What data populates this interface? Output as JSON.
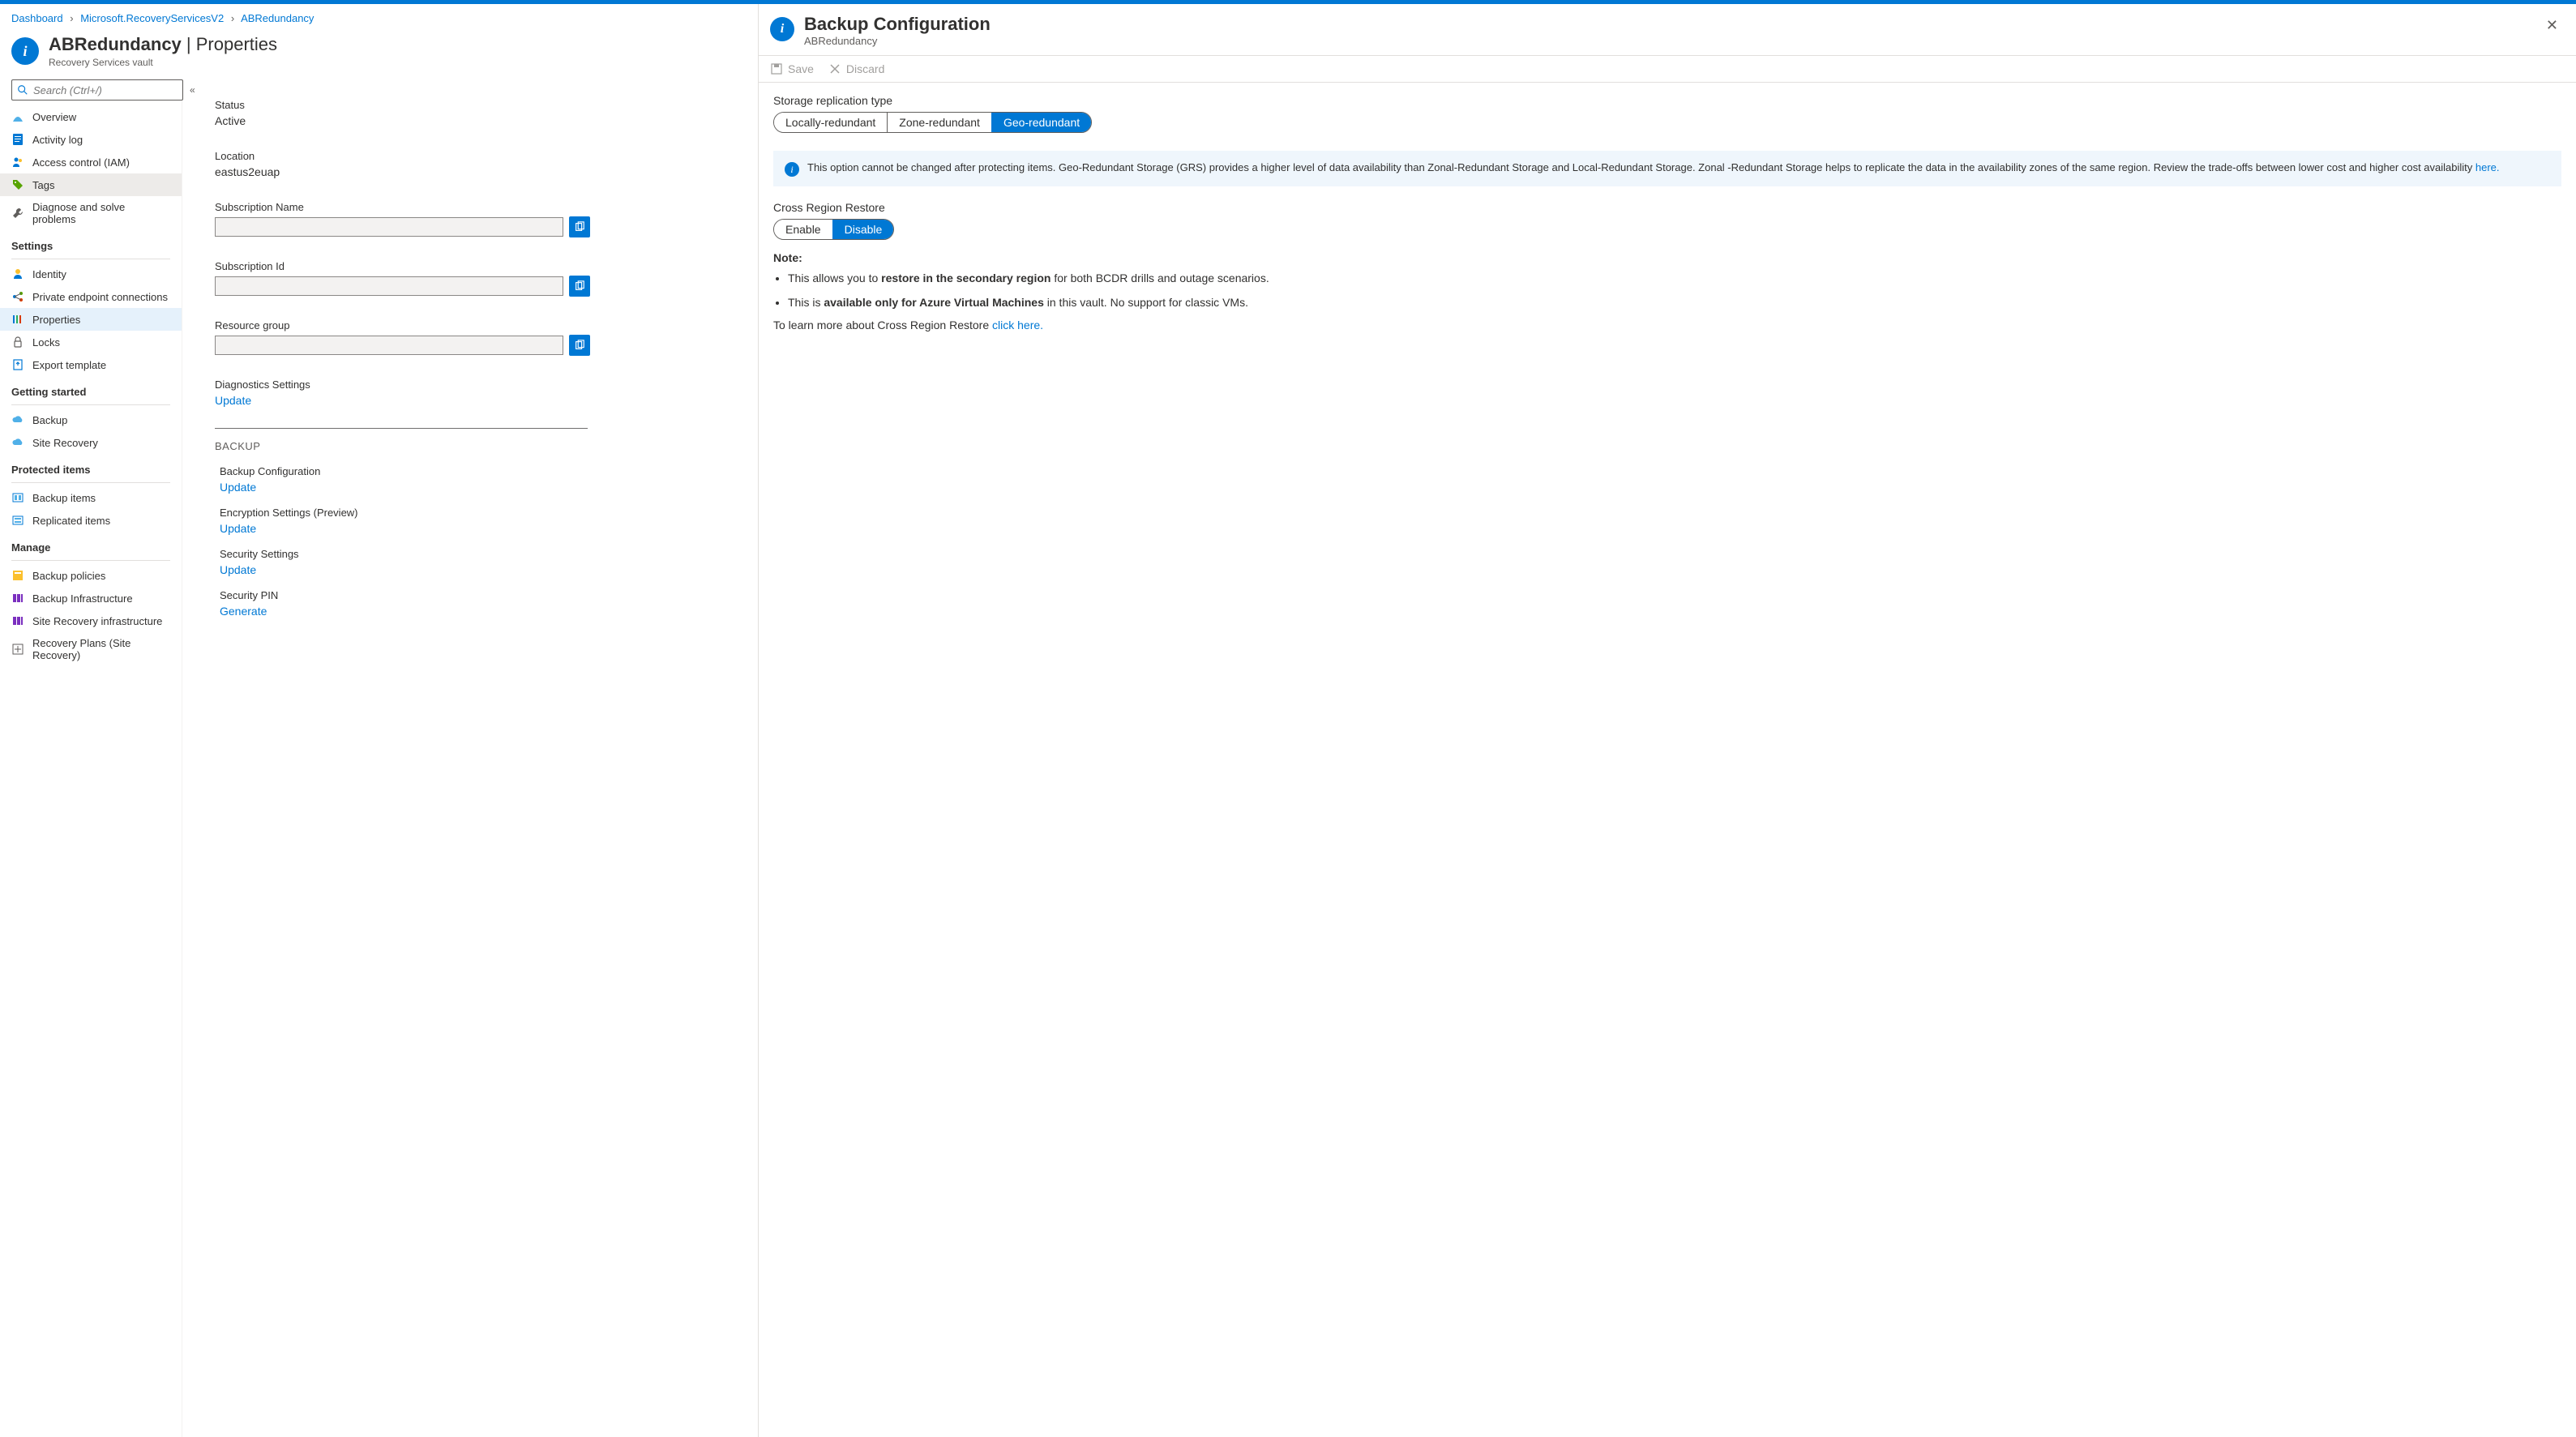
{
  "breadcrumb": {
    "items": [
      "Dashboard",
      "Microsoft.RecoveryServicesV2",
      "ABRedundancy"
    ]
  },
  "header": {
    "title_main": "ABRedundancy",
    "title_sep": " | ",
    "title_sub": "Properties",
    "subtitle": "Recovery Services vault"
  },
  "search": {
    "placeholder": "Search (Ctrl+/)"
  },
  "nav": {
    "top": [
      {
        "icon": "overview",
        "label": "Overview"
      },
      {
        "icon": "log",
        "label": "Activity log"
      },
      {
        "icon": "iam",
        "label": "Access control (IAM)"
      },
      {
        "icon": "tags",
        "label": "Tags",
        "selected_grey": true
      },
      {
        "icon": "diag",
        "label": "Diagnose and solve problems"
      }
    ],
    "settings_label": "Settings",
    "settings": [
      {
        "icon": "identity",
        "label": "Identity"
      },
      {
        "icon": "pec",
        "label": "Private endpoint connections"
      },
      {
        "icon": "props",
        "label": "Properties",
        "selected": true
      },
      {
        "icon": "locks",
        "label": "Locks"
      },
      {
        "icon": "export",
        "label": "Export template"
      }
    ],
    "getting_label": "Getting started",
    "getting": [
      {
        "icon": "backup",
        "label": "Backup"
      },
      {
        "icon": "sr",
        "label": "Site Recovery"
      }
    ],
    "protected_label": "Protected items",
    "protected": [
      {
        "icon": "bitems",
        "label": "Backup items"
      },
      {
        "icon": "ritems",
        "label": "Replicated items"
      }
    ],
    "manage_label": "Manage",
    "manage": [
      {
        "icon": "bpol",
        "label": "Backup policies"
      },
      {
        "icon": "binfra",
        "label": "Backup Infrastructure"
      },
      {
        "icon": "srinfra",
        "label": "Site Recovery infrastructure"
      },
      {
        "icon": "rplans",
        "label": "Recovery Plans (Site Recovery)"
      }
    ]
  },
  "content": {
    "status_label": "Status",
    "status_value": "Active",
    "location_label": "Location",
    "location_value": "eastus2euap",
    "subname_label": "Subscription Name",
    "subid_label": "Subscription Id",
    "rg_label": "Resource group",
    "diag_label": "Diagnostics Settings",
    "update": "Update",
    "backup_head": "BACKUP",
    "items": [
      {
        "l": "Backup Configuration",
        "a": "Update"
      },
      {
        "l": "Encryption Settings (Preview)",
        "a": "Update"
      },
      {
        "l": "Security Settings",
        "a": "Update"
      },
      {
        "l": "Security PIN",
        "a": "Generate"
      }
    ]
  },
  "panel": {
    "title": "Backup Configuration",
    "sub": "ABRedundancy",
    "save": "Save",
    "discard": "Discard",
    "repl_label": "Storage replication type",
    "repl_opts": [
      "Locally-redundant",
      "Zone-redundant",
      "Geo-redundant"
    ],
    "repl_active": 2,
    "info": "This option cannot be changed after protecting items. Geo-Redundant Storage (GRS) provides a higher level of data availability than Zonal-Redundant Storage and Local-Redundant Storage. Zonal -Redundant Storage helps to replicate the data in the availability zones of the same region. Review the trade-offs between lower cost and higher cost availability ",
    "info_link": "here.",
    "crr_label": "Cross Region Restore",
    "crr_opts": [
      "Enable",
      "Disable"
    ],
    "crr_active": 1,
    "note_label": "Note:",
    "note1_a": "This allows you to ",
    "note1_b": "restore in the secondary region",
    "note1_c": " for both BCDR drills and outage scenarios.",
    "note2_a": "This is ",
    "note2_b": "available only for Azure Virtual Machines",
    "note2_c": " in this vault. No support for classic VMs.",
    "learn": "To learn more about Cross Region Restore ",
    "learn_link": "click here."
  }
}
